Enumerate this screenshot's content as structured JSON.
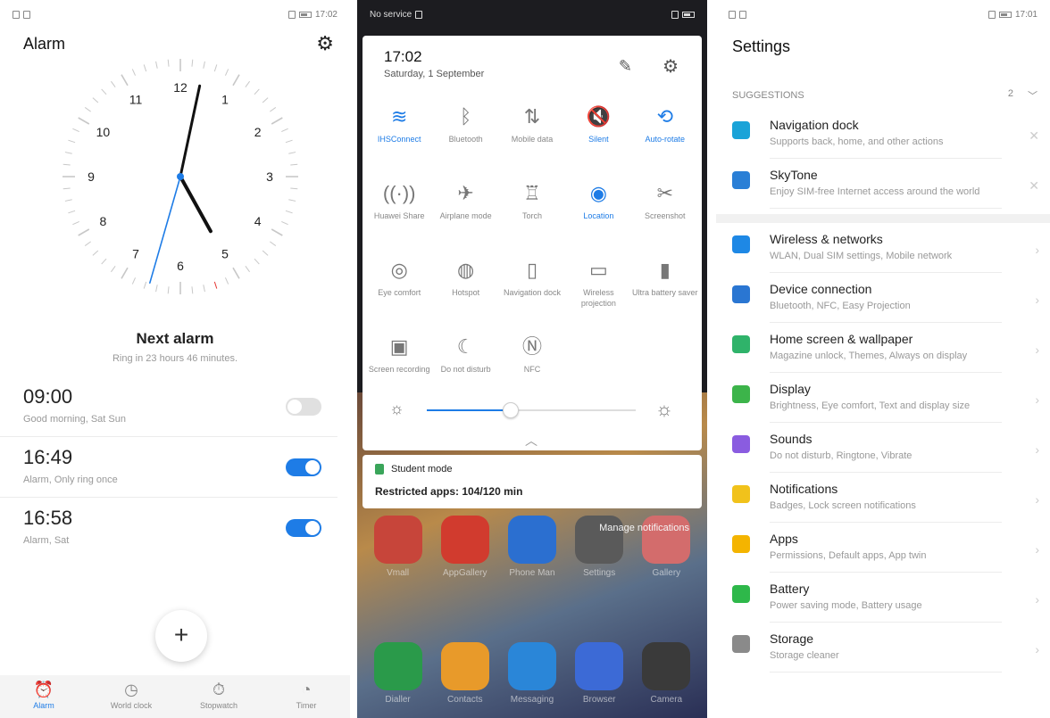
{
  "colors": {
    "accent": "#1e7ce6"
  },
  "alarm_screen": {
    "status_time": "17:02",
    "title": "Alarm",
    "clock_numbers": [
      "12",
      "1",
      "2",
      "3",
      "4",
      "5",
      "6",
      "7",
      "8",
      "9",
      "10",
      "11"
    ],
    "next_alarm_title": "Next alarm",
    "next_alarm_sub": "Ring in 23 hours 46 minutes.",
    "alarms": [
      {
        "time": "09:00",
        "desc": "Good morning, Sat Sun",
        "enabled": false
      },
      {
        "time": "16:49",
        "desc": "Alarm, Only ring once",
        "enabled": true
      },
      {
        "time": "16:58",
        "desc": "Alarm, Sat",
        "enabled": true
      }
    ],
    "fab_label": "+",
    "tabs": [
      {
        "label": "Alarm",
        "icon": "alarm-icon",
        "glyph": "⏰"
      },
      {
        "label": "World clock",
        "icon": "world-clock-icon",
        "glyph": "◷"
      },
      {
        "label": "Stopwatch",
        "icon": "stopwatch-icon",
        "glyph": "⏱"
      },
      {
        "label": "Timer",
        "icon": "timer-icon",
        "glyph": "◔"
      }
    ]
  },
  "quick_settings": {
    "status_left": "No service",
    "time": "17:02",
    "date": "Saturday, 1 September",
    "tiles": [
      {
        "label": "IHSConnect",
        "glyph": "≋",
        "on": true,
        "icon": "wifi-icon"
      },
      {
        "label": "Bluetooth",
        "glyph": "ᛒ",
        "on": false,
        "icon": "bluetooth-icon"
      },
      {
        "label": "Mobile data",
        "glyph": "⇅",
        "on": false,
        "icon": "mobile-data-icon"
      },
      {
        "label": "Silent",
        "glyph": "🔇",
        "on": true,
        "icon": "silent-icon"
      },
      {
        "label": "Auto-rotate",
        "glyph": "⟲",
        "on": true,
        "icon": "auto-rotate-icon"
      },
      {
        "label": "Huawei Share",
        "glyph": "((·))",
        "on": false,
        "icon": "huawei-share-icon"
      },
      {
        "label": "Airplane mode",
        "glyph": "✈",
        "on": false,
        "icon": "airplane-icon"
      },
      {
        "label": "Torch",
        "glyph": "♖",
        "on": false,
        "icon": "torch-icon"
      },
      {
        "label": "Location",
        "glyph": "◉",
        "on": true,
        "icon": "location-icon"
      },
      {
        "label": "Screenshot",
        "glyph": "✂",
        "on": false,
        "icon": "screenshot-icon"
      },
      {
        "label": "Eye comfort",
        "glyph": "◎",
        "on": false,
        "icon": "eye-comfort-icon"
      },
      {
        "label": "Hotspot",
        "glyph": "◍",
        "on": false,
        "icon": "hotspot-icon"
      },
      {
        "label": "Navigation dock",
        "glyph": "▯",
        "on": false,
        "icon": "navigation-dock-icon"
      },
      {
        "label": "Wireless projection",
        "glyph": "▭",
        "on": false,
        "icon": "wireless-projection-icon"
      },
      {
        "label": "Ultra battery saver",
        "glyph": "▮",
        "on": false,
        "icon": "battery-saver-icon"
      },
      {
        "label": "Screen recording",
        "glyph": "▣",
        "on": false,
        "icon": "screen-recording-icon"
      },
      {
        "label": "Do not disturb",
        "glyph": "☾",
        "on": false,
        "icon": "dnd-icon"
      },
      {
        "label": "NFC",
        "glyph": "Ⓝ",
        "on": false,
        "icon": "nfc-icon"
      }
    ],
    "brightness_level": 0.4,
    "notification_app": "Student mode",
    "notification_text": "Restricted apps: 104/120 min",
    "manage_notifications": "Manage notifications",
    "home_apps_row1": [
      {
        "label": "Vmall",
        "color": "#c7453a"
      },
      {
        "label": "AppGallery",
        "color": "#d13b2e"
      },
      {
        "label": "Phone Man",
        "color": "#2b6fd0"
      },
      {
        "label": "Settings",
        "color": "#5a5a5a"
      },
      {
        "label": "Gallery",
        "color": "#d36c6c"
      }
    ],
    "home_apps_row2": [
      {
        "label": "Dialler",
        "color": "#2a9a4a"
      },
      {
        "label": "Contacts",
        "color": "#e89a2a"
      },
      {
        "label": "Messaging",
        "color": "#2a86d8"
      },
      {
        "label": "Browser",
        "color": "#3c6ad6"
      },
      {
        "label": "Camera",
        "color": "#3a3a3a"
      }
    ]
  },
  "settings": {
    "status_time": "17:01",
    "title": "Settings",
    "suggestions_label": "SUGGESTIONS",
    "suggestions_count": "2",
    "suggestions": [
      {
        "title": "Navigation dock",
        "sub": "Supports back, home, and other actions",
        "color": "#1aa3d8",
        "icon": "navigation-dock-icon"
      },
      {
        "title": "SkyTone",
        "sub": "Enjoy SIM-free Internet access around the world",
        "color": "#2a7fd6",
        "icon": "skytone-icon"
      }
    ],
    "items": [
      {
        "title": "Wireless & networks",
        "sub": "WLAN, Dual SIM settings, Mobile network",
        "color": "#1e88e5",
        "icon": "wifi-icon"
      },
      {
        "title": "Device connection",
        "sub": "Bluetooth, NFC, Easy Projection",
        "color": "#2a76d2",
        "icon": "device-connection-icon"
      },
      {
        "title": "Home screen & wallpaper",
        "sub": "Magazine unlock, Themes, Always on display",
        "color": "#2fb36a",
        "icon": "wallpaper-icon"
      },
      {
        "title": "Display",
        "sub": "Brightness, Eye comfort, Text and display size",
        "color": "#3cb44a",
        "icon": "display-icon"
      },
      {
        "title": "Sounds",
        "sub": "Do not disturb, Ringtone, Vibrate",
        "color": "#8a5ce0",
        "icon": "sound-icon"
      },
      {
        "title": "Notifications",
        "sub": "Badges, Lock screen notifications",
        "color": "#f1c21b",
        "icon": "notification-icon"
      },
      {
        "title": "Apps",
        "sub": "Permissions, Default apps, App twin",
        "color": "#f4b400",
        "icon": "apps-icon"
      },
      {
        "title": "Battery",
        "sub": "Power saving mode, Battery usage",
        "color": "#2eb84a",
        "icon": "battery-icon"
      },
      {
        "title": "Storage",
        "sub": "Storage cleaner",
        "color": "#8a8a8a",
        "icon": "storage-icon"
      }
    ]
  }
}
